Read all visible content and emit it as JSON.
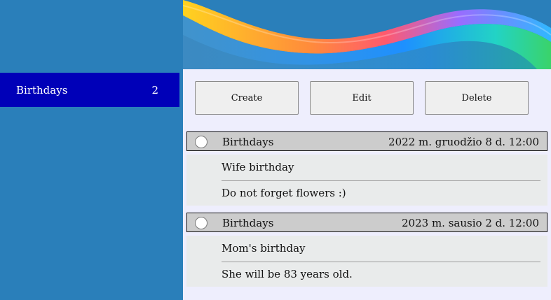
{
  "sidebar": {
    "items": [
      {
        "label": "Birthdays",
        "count": "2"
      }
    ]
  },
  "toolbar": {
    "create_label": "Create",
    "edit_label": "Edit",
    "delete_label": "Delete"
  },
  "events": [
    {
      "category": "Birthdays",
      "datetime": "2022 m. gruodžio 8 d. 12:00",
      "title": "Wife birthday",
      "description": "Do not forget flowers :)",
      "selected": false
    },
    {
      "category": "Birthdays",
      "datetime": "2023 m. sausio 2 d. 12:00",
      "title": "Mom's birthday",
      "description": "She will be 83 years old.",
      "selected": false
    }
  ],
  "colors": {
    "background": "#2a7fba",
    "sidebar_active": "#0000b8",
    "content_background": "#eeeefd",
    "event_header": "#cccccc",
    "event_body": "#e9ebeb"
  }
}
